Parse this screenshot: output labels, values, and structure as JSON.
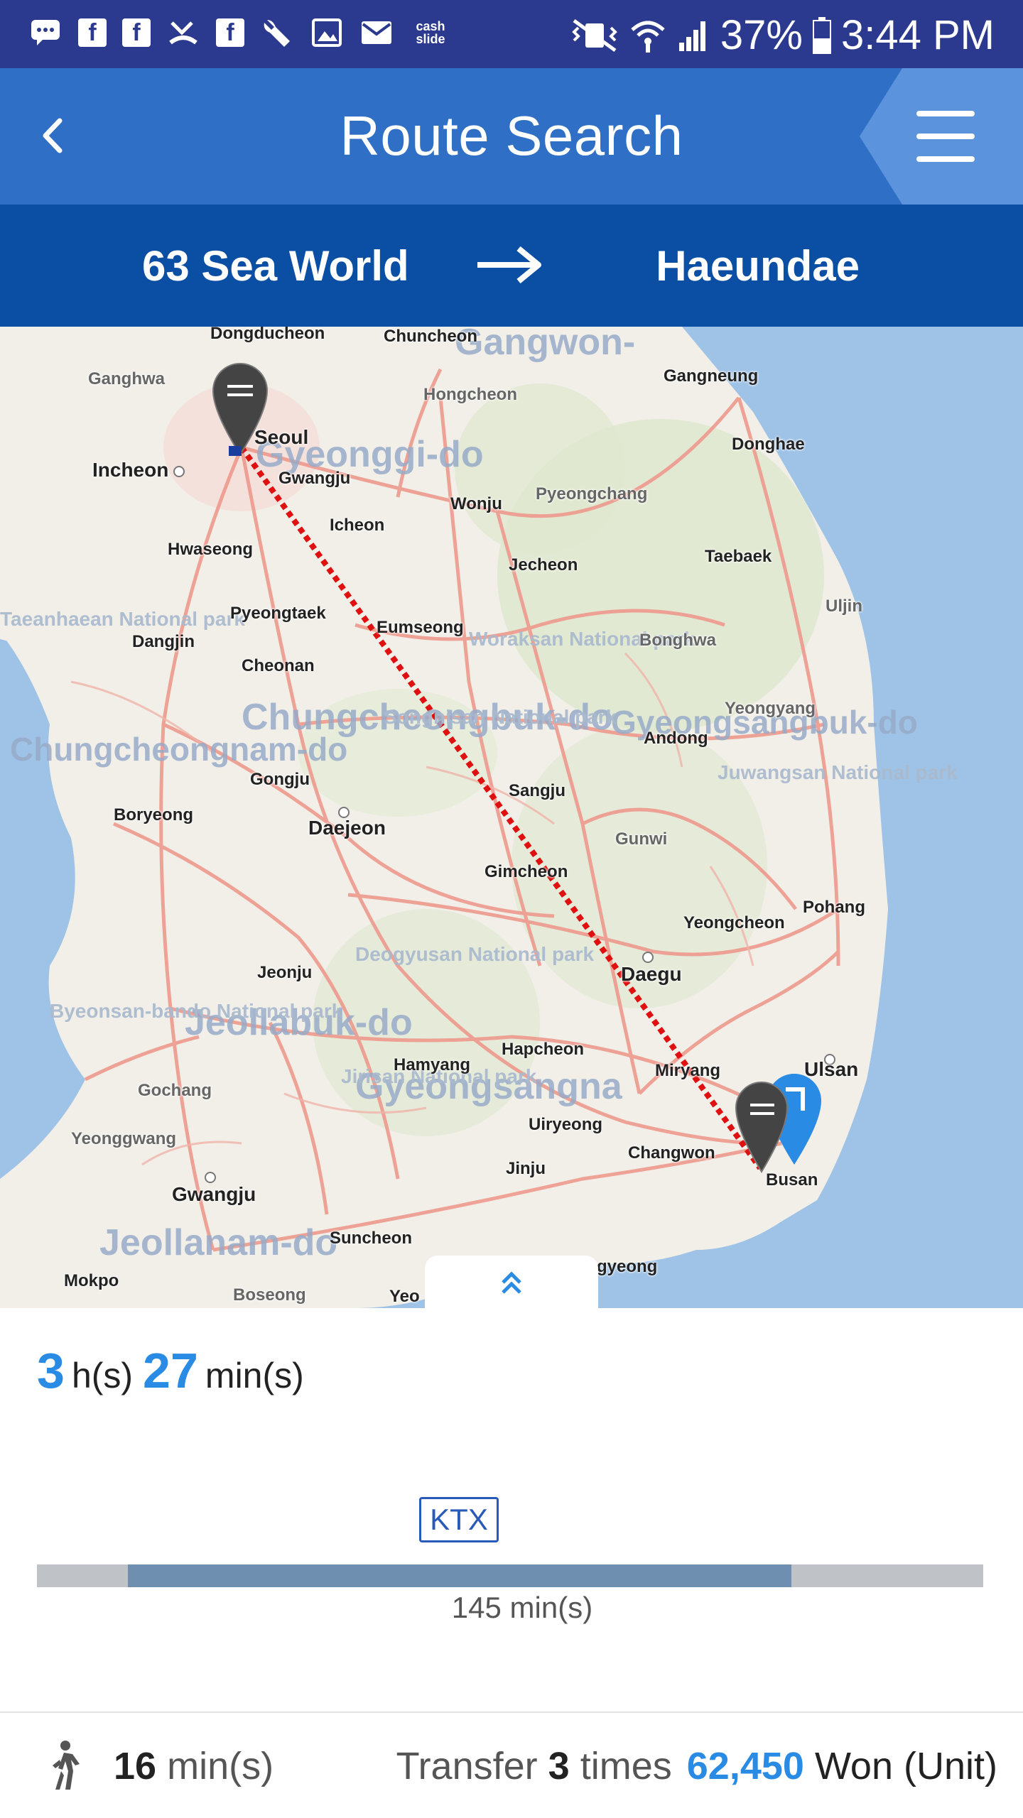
{
  "status_bar": {
    "icons": [
      "chat-icon",
      "facebook-icon",
      "facebook-icon",
      "missed-call-icon",
      "facebook-icon",
      "wrench-icon",
      "image-icon",
      "mail-icon"
    ],
    "cashslide_line1": "cash",
    "cashslide_line2": "slide",
    "battery": "37%",
    "time": "3:44 PM"
  },
  "header": {
    "title": "Route Search",
    "back_icon": "chevron-left-icon",
    "menu_icon": "hamburger-menu-icon"
  },
  "route": {
    "from": "63 Sea World",
    "to": "Haeundae",
    "arrow_icon": "arrow-right-icon"
  },
  "map": {
    "cities": [
      {
        "name": "Dongducheon"
      },
      {
        "name": "Chuncheon"
      },
      {
        "name": "Ganghwa"
      },
      {
        "name": "Gangneung"
      },
      {
        "name": "Hongcheon"
      },
      {
        "name": "Seoul"
      },
      {
        "name": "Incheon"
      },
      {
        "name": "Donghae"
      },
      {
        "name": "Gwangju"
      },
      {
        "name": "Wonju"
      },
      {
        "name": "Pyeongchang"
      },
      {
        "name": "Icheon"
      },
      {
        "name": "Hwaseong"
      },
      {
        "name": "Jecheon"
      },
      {
        "name": "Taebaek"
      },
      {
        "name": "Uljin"
      },
      {
        "name": "Pyeongtaek"
      },
      {
        "name": "Eumseong"
      },
      {
        "name": "Bonghwa"
      },
      {
        "name": "Dangjin"
      },
      {
        "name": "Cheonan"
      },
      {
        "name": "Yeongyang"
      },
      {
        "name": "Andong"
      },
      {
        "name": "Gongju"
      },
      {
        "name": "Sangju"
      },
      {
        "name": "Boryeong"
      },
      {
        "name": "Daejeon"
      },
      {
        "name": "Gunwi"
      },
      {
        "name": "Gimcheon"
      },
      {
        "name": "Pohang"
      },
      {
        "name": "Yeongcheon"
      },
      {
        "name": "Jeonju"
      },
      {
        "name": "Daegu"
      },
      {
        "name": "Hapcheon"
      },
      {
        "name": "Ulsan"
      },
      {
        "name": "Hamyang"
      },
      {
        "name": "Miryang"
      },
      {
        "name": "Gochang"
      },
      {
        "name": "Uiryeong"
      },
      {
        "name": "Yeonggwang"
      },
      {
        "name": "Changwon"
      },
      {
        "name": "Jinju"
      },
      {
        "name": "Gwangju"
      },
      {
        "name": "Suncheon"
      },
      {
        "name": "Mokpo"
      },
      {
        "name": "Boseong"
      },
      {
        "name": "Yeo"
      },
      {
        "name": "gyeong"
      },
      {
        "name": "Busan"
      }
    ],
    "regions": [
      "Gangwon-",
      "Gyeonggi-do",
      "Chungcheongbuk-do",
      "Gyeongsangbuk-do",
      "Chungcheongnam-do",
      "Jeollabuk-do",
      "Gyeongsangna",
      "Jeollanam-do"
    ],
    "parks": [
      "Taeanhaean National park",
      "Woraksan National park",
      "Songnisan National park",
      "Juwangsan National park",
      "Deogyusan National park",
      "Byeonsan-bando National park",
      "Jirisan National park"
    ],
    "expand_icon": "double-chevron-up-icon"
  },
  "summary": {
    "hours": "3",
    "hours_unit": "h(s)",
    "minutes": "27",
    "minutes_unit": "min(s)",
    "segment": {
      "mode": "KTX",
      "duration": "145 min(s)",
      "start_fraction": 0.096,
      "end_fraction": 0.797
    }
  },
  "footer": {
    "walk_icon": "walking-person-icon",
    "walk_minutes": "16",
    "walk_unit": "min(s)",
    "transfer_label": "Transfer",
    "transfer_count": "3",
    "transfer_unit": "times",
    "fare": "62,450",
    "fare_unit": "Won (Unit)"
  },
  "colors": {
    "status_bar": "#2b3a8f",
    "header": "#2f6fc6",
    "route_bar": "#0b4fa5",
    "accent": "#2a8be4",
    "route_line": "#e01010",
    "progress_fill": "#6f8fb0",
    "progress_track": "#bfc3c8"
  }
}
